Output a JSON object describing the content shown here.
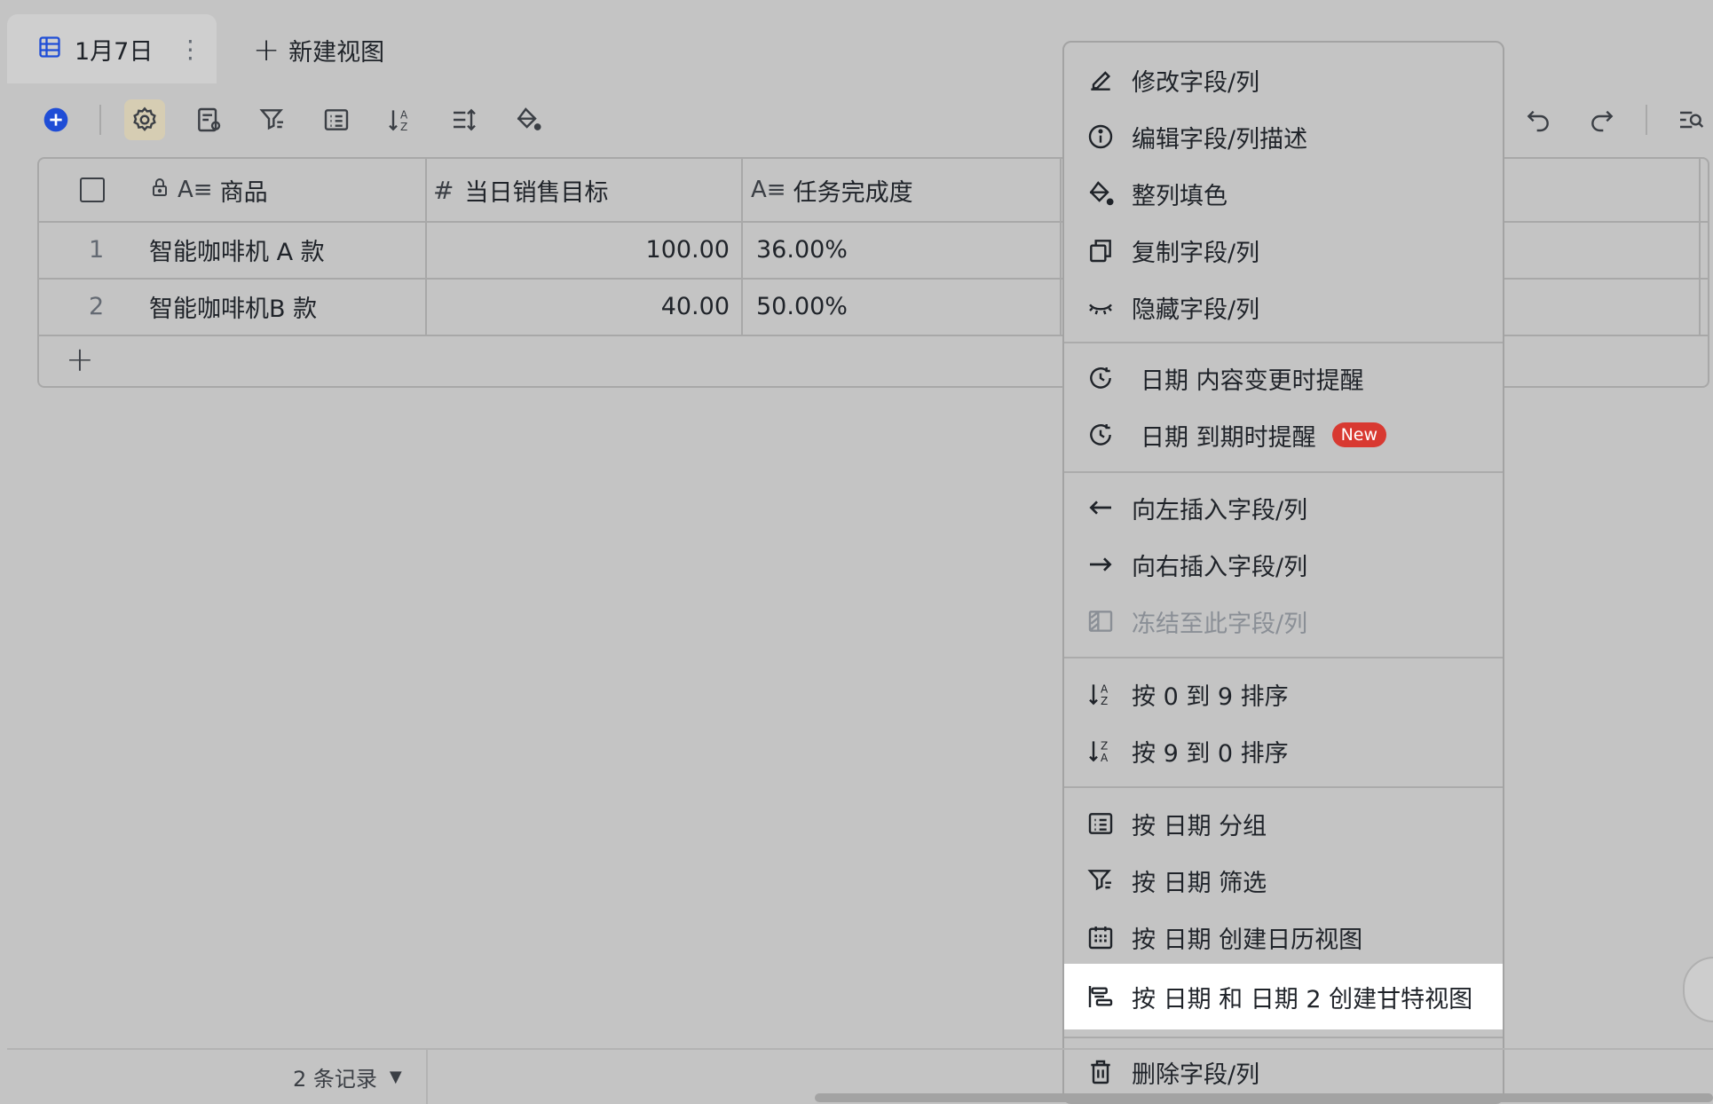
{
  "tabs": {
    "active": {
      "label": "1月7日",
      "icon": "table-icon",
      "more_icon": "more-vertical-icon"
    },
    "new_view_label": "新建视图"
  },
  "toolbar": {
    "left_icons": [
      "add-circle-icon",
      "settings-gear-icon",
      "form-icon",
      "filter-icon",
      "group-icon",
      "sort-icon",
      "row-height-icon",
      "fill-color-icon"
    ],
    "right_icons": [
      "undo-icon",
      "redo-icon",
      "search-icon"
    ],
    "accent": "#1f4dd6"
  },
  "table": {
    "columns": [
      {
        "label": "商品",
        "type_icon": "text-type-icon",
        "locked": true
      },
      {
        "label": "当日销售目标",
        "type_icon": "number-type-icon"
      },
      {
        "label": "任务完成度",
        "type_icon": "text-type-icon"
      }
    ],
    "rows": [
      {
        "index": "1",
        "product": "智能咖啡机 A 款",
        "target": "100.00",
        "completion": "36.00%"
      },
      {
        "index": "2",
        "product": "智能咖啡机B 款",
        "target": "40.00",
        "completion": "50.00%"
      }
    ]
  },
  "menu": {
    "items": [
      {
        "label": "修改字段/列",
        "icon": "edit-pen-icon"
      },
      {
        "label": "编辑字段/列描述",
        "icon": "info-icon"
      },
      {
        "label": "整列填色",
        "icon": "paint-bucket-icon"
      },
      {
        "label": "复制字段/列",
        "icon": "copy-icon"
      },
      {
        "label": "隐藏字段/列",
        "icon": "eye-closed-icon"
      },
      {
        "label": "日期 内容变更时提醒",
        "icon": "clock-reminder-icon"
      },
      {
        "label": "日期 到期时提醒",
        "icon": "clock-reminder-icon",
        "badge": "New"
      },
      {
        "label": "向左插入字段/列",
        "icon": "arrow-left-icon"
      },
      {
        "label": "向右插入字段/列",
        "icon": "arrow-right-icon"
      },
      {
        "label": "冻结至此字段/列",
        "icon": "freeze-column-icon",
        "disabled": true
      },
      {
        "label": "按 0 到 9 排序",
        "icon": "sort-ascending-icon"
      },
      {
        "label": "按 9 到 0 排序",
        "icon": "sort-descending-icon"
      },
      {
        "label": "按 日期 分组",
        "icon": "group-list-icon"
      },
      {
        "label": "按 日期 筛选",
        "icon": "filter-icon"
      },
      {
        "label": "按 日期 创建日历视图",
        "icon": "calendar-icon"
      },
      {
        "label": "按 日期 和 日期 2 创建甘特视图",
        "icon": "gantt-icon",
        "highlighted": true
      },
      {
        "label": "删除字段/列",
        "icon": "trash-icon"
      }
    ]
  },
  "footer": {
    "records_label": "2 条记录"
  }
}
